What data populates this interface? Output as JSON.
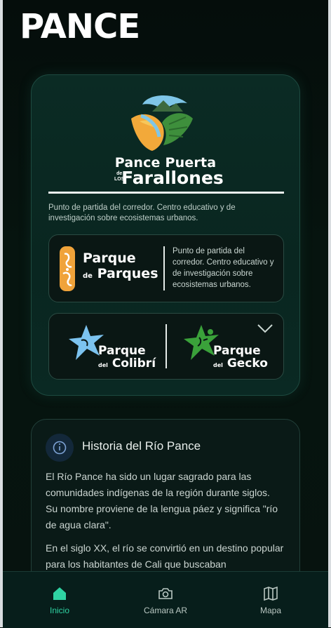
{
  "app": {
    "logo_text": "PANCE"
  },
  "hero": {
    "title_line1": "Pance Puerta",
    "de_los": "de\nLOS",
    "title_line2": "Farallones",
    "description": "Punto de partida del corredor. Centro educativo y de investigación sobre ecosistemas urbanos."
  },
  "parque_de_parques": {
    "title_a": "Parque",
    "title_de": "de",
    "title_b": "Parques",
    "description": "Punto de partida del corredor. Centro educativo y de investigación sobre ecosistemas urbanos."
  },
  "parques": {
    "colibri": {
      "a": "Parque",
      "del": "del",
      "b": "Colibrí"
    },
    "gecko": {
      "a": "Parque",
      "del": "del",
      "b": "Gecko"
    }
  },
  "historia": {
    "title": "Historia del Río Pance",
    "p1": "El Río Pance ha sido un lugar sagrado para las comunidades indígenas de la región durante siglos. Su nombre proviene de la lengua páez y significa \"río de agua clara\".",
    "p2": "En el siglo XX, el río se convirtió en un destino popular para los habitantes de Cali que buscaban"
  },
  "nav": {
    "inicio": "Inicio",
    "camara": "Cámara AR",
    "mapa": "Mapa"
  },
  "colors": {
    "accent": "#2fd3a3",
    "background": "#06140f"
  }
}
